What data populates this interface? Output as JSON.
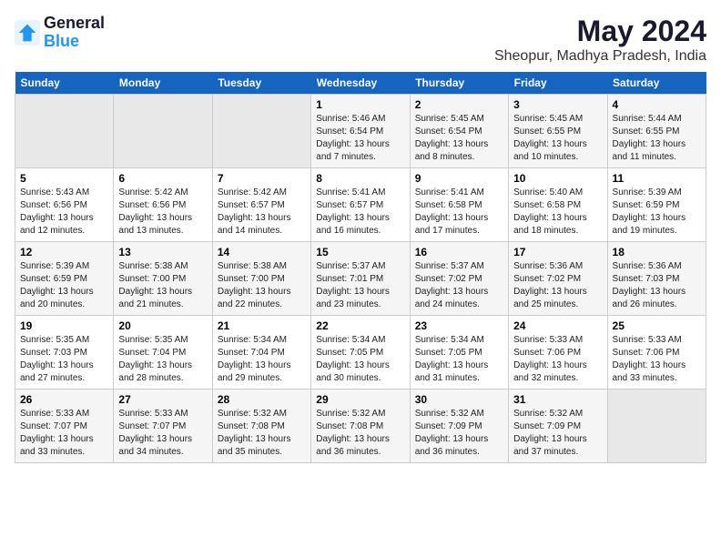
{
  "logo": {
    "line1": "General",
    "line2": "Blue"
  },
  "title": "May 2024",
  "subtitle": "Sheopur, Madhya Pradesh, India",
  "days_of_week": [
    "Sunday",
    "Monday",
    "Tuesday",
    "Wednesday",
    "Thursday",
    "Friday",
    "Saturday"
  ],
  "weeks": [
    [
      {
        "day": "",
        "empty": true
      },
      {
        "day": "",
        "empty": true
      },
      {
        "day": "",
        "empty": true
      },
      {
        "day": "1",
        "sunrise": "5:46 AM",
        "sunset": "6:54 PM",
        "daylight": "13 hours and 7 minutes."
      },
      {
        "day": "2",
        "sunrise": "5:45 AM",
        "sunset": "6:54 PM",
        "daylight": "13 hours and 8 minutes."
      },
      {
        "day": "3",
        "sunrise": "5:45 AM",
        "sunset": "6:55 PM",
        "daylight": "13 hours and 10 minutes."
      },
      {
        "day": "4",
        "sunrise": "5:44 AM",
        "sunset": "6:55 PM",
        "daylight": "13 hours and 11 minutes."
      }
    ],
    [
      {
        "day": "5",
        "sunrise": "5:43 AM",
        "sunset": "6:56 PM",
        "daylight": "13 hours and 12 minutes."
      },
      {
        "day": "6",
        "sunrise": "5:42 AM",
        "sunset": "6:56 PM",
        "daylight": "13 hours and 13 minutes."
      },
      {
        "day": "7",
        "sunrise": "5:42 AM",
        "sunset": "6:57 PM",
        "daylight": "13 hours and 14 minutes."
      },
      {
        "day": "8",
        "sunrise": "5:41 AM",
        "sunset": "6:57 PM",
        "daylight": "13 hours and 16 minutes."
      },
      {
        "day": "9",
        "sunrise": "5:41 AM",
        "sunset": "6:58 PM",
        "daylight": "13 hours and 17 minutes."
      },
      {
        "day": "10",
        "sunrise": "5:40 AM",
        "sunset": "6:58 PM",
        "daylight": "13 hours and 18 minutes."
      },
      {
        "day": "11",
        "sunrise": "5:39 AM",
        "sunset": "6:59 PM",
        "daylight": "13 hours and 19 minutes."
      }
    ],
    [
      {
        "day": "12",
        "sunrise": "5:39 AM",
        "sunset": "6:59 PM",
        "daylight": "13 hours and 20 minutes."
      },
      {
        "day": "13",
        "sunrise": "5:38 AM",
        "sunset": "7:00 PM",
        "daylight": "13 hours and 21 minutes."
      },
      {
        "day": "14",
        "sunrise": "5:38 AM",
        "sunset": "7:00 PM",
        "daylight": "13 hours and 22 minutes."
      },
      {
        "day": "15",
        "sunrise": "5:37 AM",
        "sunset": "7:01 PM",
        "daylight": "13 hours and 23 minutes."
      },
      {
        "day": "16",
        "sunrise": "5:37 AM",
        "sunset": "7:02 PM",
        "daylight": "13 hours and 24 minutes."
      },
      {
        "day": "17",
        "sunrise": "5:36 AM",
        "sunset": "7:02 PM",
        "daylight": "13 hours and 25 minutes."
      },
      {
        "day": "18",
        "sunrise": "5:36 AM",
        "sunset": "7:03 PM",
        "daylight": "13 hours and 26 minutes."
      }
    ],
    [
      {
        "day": "19",
        "sunrise": "5:35 AM",
        "sunset": "7:03 PM",
        "daylight": "13 hours and 27 minutes."
      },
      {
        "day": "20",
        "sunrise": "5:35 AM",
        "sunset": "7:04 PM",
        "daylight": "13 hours and 28 minutes."
      },
      {
        "day": "21",
        "sunrise": "5:34 AM",
        "sunset": "7:04 PM",
        "daylight": "13 hours and 29 minutes."
      },
      {
        "day": "22",
        "sunrise": "5:34 AM",
        "sunset": "7:05 PM",
        "daylight": "13 hours and 30 minutes."
      },
      {
        "day": "23",
        "sunrise": "5:34 AM",
        "sunset": "7:05 PM",
        "daylight": "13 hours and 31 minutes."
      },
      {
        "day": "24",
        "sunrise": "5:33 AM",
        "sunset": "7:06 PM",
        "daylight": "13 hours and 32 minutes."
      },
      {
        "day": "25",
        "sunrise": "5:33 AM",
        "sunset": "7:06 PM",
        "daylight": "13 hours and 33 minutes."
      }
    ],
    [
      {
        "day": "26",
        "sunrise": "5:33 AM",
        "sunset": "7:07 PM",
        "daylight": "13 hours and 33 minutes."
      },
      {
        "day": "27",
        "sunrise": "5:33 AM",
        "sunset": "7:07 PM",
        "daylight": "13 hours and 34 minutes."
      },
      {
        "day": "28",
        "sunrise": "5:32 AM",
        "sunset": "7:08 PM",
        "daylight": "13 hours and 35 minutes."
      },
      {
        "day": "29",
        "sunrise": "5:32 AM",
        "sunset": "7:08 PM",
        "daylight": "13 hours and 36 minutes."
      },
      {
        "day": "30",
        "sunrise": "5:32 AM",
        "sunset": "7:09 PM",
        "daylight": "13 hours and 36 minutes."
      },
      {
        "day": "31",
        "sunrise": "5:32 AM",
        "sunset": "7:09 PM",
        "daylight": "13 hours and 37 minutes."
      },
      {
        "day": "",
        "empty": true
      }
    ]
  ]
}
